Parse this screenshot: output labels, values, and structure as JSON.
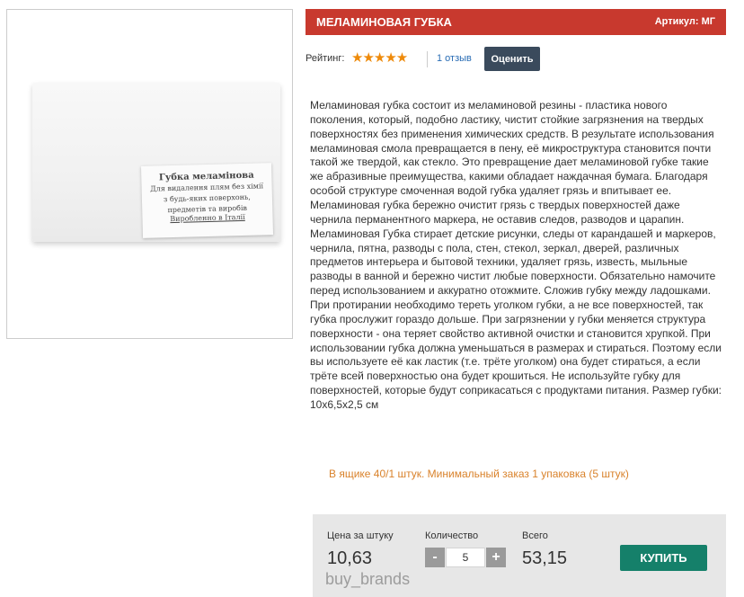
{
  "product": {
    "title": "МЕЛАМИНОВАЯ ГУБКА",
    "article": "Артикул: МГ",
    "image_label": {
      "title": "Губка меламінова",
      "lines": [
        "Для видалення плям без хімії",
        "з будь-яких поверхонь,",
        "предметів та виробів"
      ],
      "footer": "Виробленно в Італії"
    }
  },
  "rating": {
    "label": "Рейтинг:",
    "stars": "★★★★★",
    "stars_value": 5,
    "stars_max": 5,
    "reviews": "1 отзыв",
    "rate_button": "Оценить"
  },
  "description": "Меламиновая губка состоит из меламиновой резины - пластика нового поколения, который, подобно ластику, чистит стойкие загрязнения на твердых поверхностях без применения химических средств. В результате использования меламиновая смола превращается в пену, её микроструктура становится почти такой же твердой, как стекло. Это превращение дает меламиновой губке такие же абразивные преимущества, какими обладает наждачная бумага. Благодаря особой структуре смоченная водой губка удаляет грязь и впитывает ее. Меламиновая губка бережно очистит грязь с твердых поверхностей даже чернила перманентного маркера, не оставив следов, разводов и царапин. Меламиновая Губка стирает детские рисунки, следы от карандашей и маркеров, чернила, пятна, разводы с пола, стен, стекол, зеркал, дверей, различных предметов интерьера и бытовой техники, удаляет грязь, известь, мыльные разводы в ванной и бережно чистит любые поверхности. Обязательно намочите перед использованием и аккуратно отожмите. Сложив губку между ладошками. При протирании необходимо тереть уголком губки, а не все поверхностей, так губка прослужит гораздо дольше. При загрязнении у губки меняется структура поверхности - она теряет свойство активной очистки и становится хрупкой. При использовании губка должна уменьшаться в размерах и стираться. Поэтому если вы используете её как ластик (т.е. трёте уголком) она будет стираться, а если трёте всей поверхностью она будет крошиться. Не используйте губку для поверхностей, которые будут соприкасаться с продуктами питания. Размер губки: 10х6,5х2,5 см",
  "box_info": "В ящике 40/1 штук. Минимальный заказ 1 упаковка (5 штук)",
  "purchase": {
    "price_label": "Цена за штуку",
    "price": "10,63",
    "qty_label": "Количество",
    "qty_minus": "-",
    "qty_value": "5",
    "qty_plus": "+",
    "total_label": "Всего",
    "total": "53,15",
    "buy_button": "КУПИТЬ"
  },
  "watermark": "buy_brands",
  "colors": {
    "title_bar": "#c8392e",
    "stars": "#ee8a0a",
    "link": "#2a6db5",
    "rate_button": "#3a4a5c",
    "box_info": "#d9822b",
    "buy_button": "#15806a",
    "panel": "#e7e7e7"
  }
}
